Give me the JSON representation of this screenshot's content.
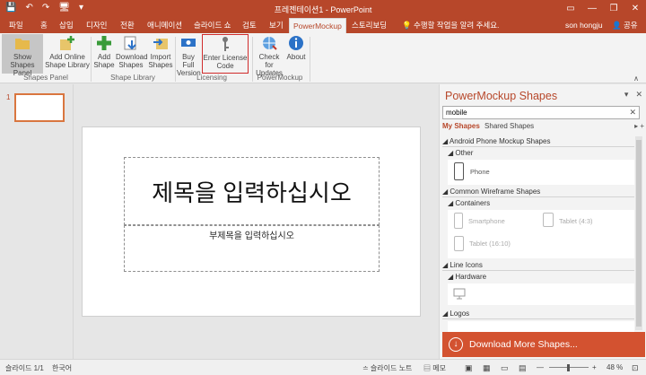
{
  "titlebar": {
    "title": "프레젠테이션1 - PowerPoint",
    "quick_access": [
      "💾",
      "↶",
      "↷",
      "🖥",
      "▾"
    ],
    "window_controls": [
      "▭",
      "—",
      "❐",
      "✕"
    ]
  },
  "tabs": [
    "파일",
    "홈",
    "삽입",
    "디자인",
    "전환",
    "애니메이션",
    "슬라이드 쇼",
    "검토",
    "보기",
    "PowerMockup",
    "스토리보딩"
  ],
  "tell_me": "💡 수행할 작업을 알려 주세요.",
  "user": "son hongju",
  "share": "공유",
  "ribbon": {
    "buttons": [
      {
        "label": "Show Shapes Panel",
        "icon": "folder-icon"
      },
      {
        "label": "Add Online Shape Library",
        "icon": "add-library-icon"
      },
      {
        "label": "Add Shape",
        "icon": "plus-icon"
      },
      {
        "label": "Download Shapes",
        "icon": "download-icon"
      },
      {
        "label": "Import Shapes",
        "icon": "import-icon"
      },
      {
        "label": "Buy Full Version",
        "icon": "cart-icon"
      },
      {
        "label": "Enter License Code",
        "icon": "key-icon"
      },
      {
        "label": "Check for Updates",
        "icon": "globe-icon"
      },
      {
        "label": "About",
        "icon": "info-icon"
      }
    ],
    "groups": [
      "Shapes Panel",
      "Shape Library",
      "Licensing",
      "PowerMockup"
    ]
  },
  "thumbnails": {
    "slide_number": "1"
  },
  "slide": {
    "title_placeholder": "제목을 입력하십시오",
    "subtitle_placeholder": "부제목을 입력하십시오"
  },
  "powermockup": {
    "title": "PowerMockup Shapes",
    "controls": [
      "▾",
      "✕"
    ],
    "search_value": "mobile",
    "search_clear": "✕",
    "tab_my": "My Shapes",
    "tab_shared": "Shared Shapes",
    "tab_arrows": "▸ +",
    "sections": [
      {
        "name": "◢ Android Phone Mockup Shapes",
        "sub": "◢ Other",
        "items": [
          "Phone"
        ]
      },
      {
        "name": "◢ Common Wireframe Shapes",
        "sub": "◢ Containers",
        "items": [
          "Smartphone",
          "Tablet (4:3)",
          "Tablet (16:10)"
        ]
      },
      {
        "name": "◢ Line Icons",
        "sub": "◢ Hardware",
        "items": []
      },
      {
        "name": "◢ Logos",
        "sub": "",
        "items": []
      }
    ],
    "footer": "Download More Shapes..."
  },
  "status": {
    "slide_info": "슬라이드 1/1",
    "language": "한국어",
    "notes": "≐ 슬라이드 노트",
    "comments": "▤ 메모",
    "zoom_minus": "—",
    "zoom_plus": "+",
    "zoom": "48 %"
  }
}
